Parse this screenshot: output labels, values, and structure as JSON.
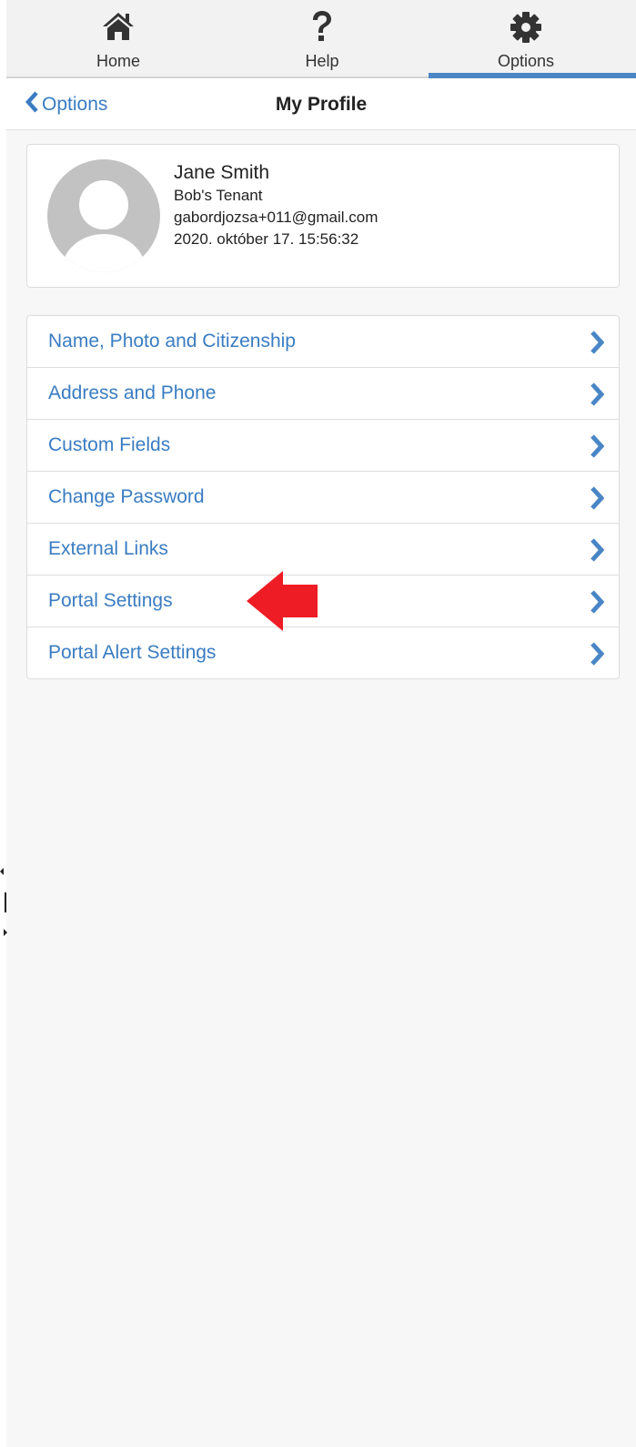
{
  "tabs": [
    {
      "label": "Home",
      "icon": "home-icon",
      "active": false
    },
    {
      "label": "Help",
      "icon": "question-icon",
      "active": false
    },
    {
      "label": "Options",
      "icon": "gear-icon",
      "active": true
    }
  ],
  "nav": {
    "back_label": "Options",
    "title": "My Profile"
  },
  "profile": {
    "name": "Jane Smith",
    "role": "Bob's Tenant",
    "email": "gabordjozsa+011@gmail.com",
    "timestamp": "2020. október 17. 15:56:32"
  },
  "menu": [
    {
      "label": "Name, Photo and Citizenship"
    },
    {
      "label": "Address and Phone"
    },
    {
      "label": "Custom Fields"
    },
    {
      "label": "Change Password"
    },
    {
      "label": "External Links"
    },
    {
      "label": "Portal Settings"
    },
    {
      "label": "Portal Alert Settings"
    }
  ],
  "colors": {
    "accent": "#3a7cc2",
    "active_tab_bar": "#4a86c5",
    "annotation_arrow": "#ee1c24"
  }
}
